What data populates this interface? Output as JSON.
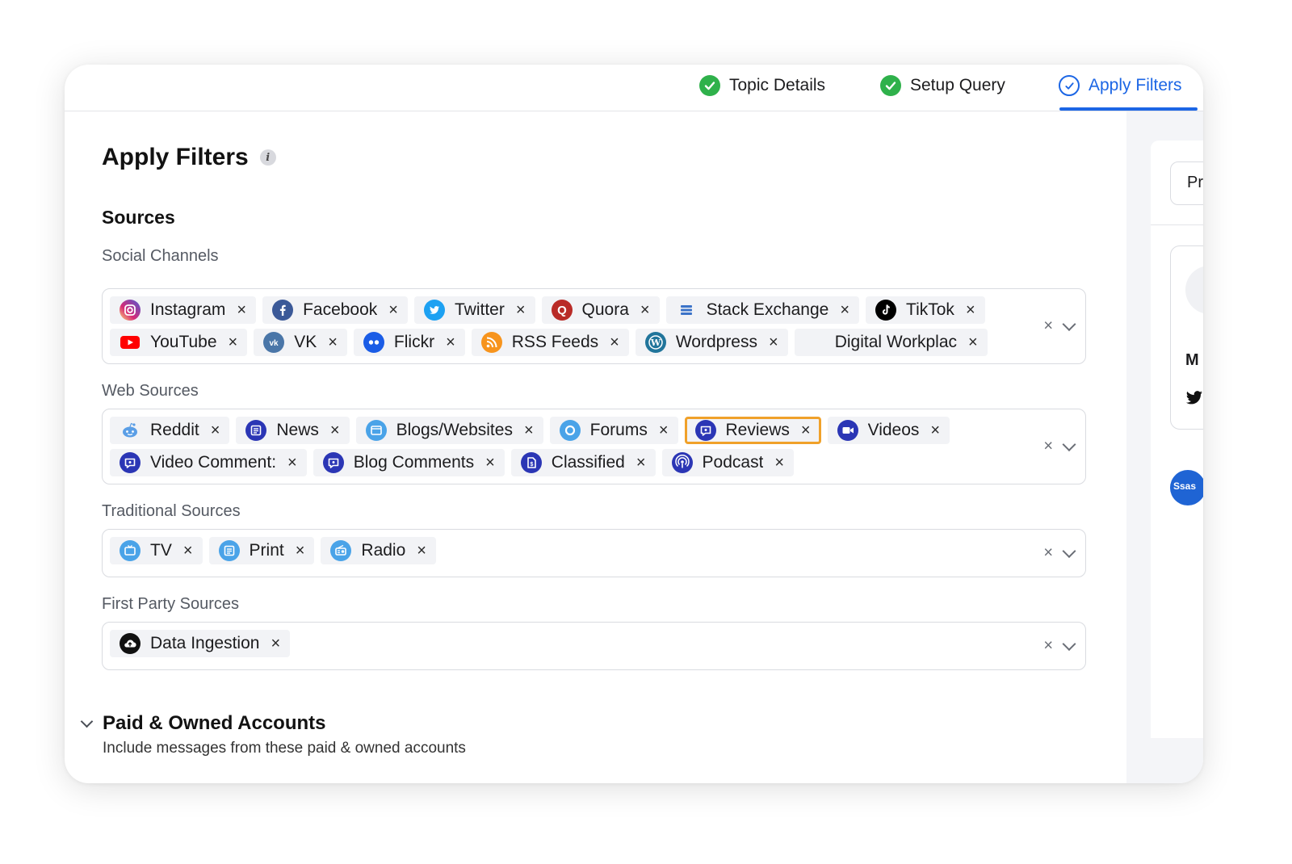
{
  "stepper": {
    "steps": [
      {
        "label": "Topic Details",
        "state": "done"
      },
      {
        "label": "Setup Query",
        "state": "done"
      },
      {
        "label": "Apply Filters",
        "state": "current"
      }
    ]
  },
  "page": {
    "title": "Apply Filters",
    "info_icon": "i",
    "section_title": "Sources"
  },
  "groups": {
    "social": {
      "label": "Social Channels",
      "rows": [
        [
          {
            "label": "Instagram",
            "icon": "instagram-icon",
            "color": "#d62976"
          },
          {
            "label": "Facebook",
            "icon": "facebook-icon",
            "color": "#3b5998"
          },
          {
            "label": "Twitter",
            "icon": "twitter-icon",
            "color": "#1da1f2"
          },
          {
            "label": "Quora",
            "icon": "quora-icon",
            "color": "#b92b27"
          },
          {
            "label": "Stack Exchange",
            "icon": "stack-exchange-icon",
            "color": "#3b73c8"
          },
          {
            "label": "TikTok",
            "icon": "tiktok-icon",
            "color": "#000000"
          }
        ],
        [
          {
            "label": "YouTube",
            "icon": "youtube-icon",
            "color": "#ff0000"
          },
          {
            "label": "VK",
            "icon": "vk-icon",
            "color": "#4a76a8"
          },
          {
            "label": "Flickr",
            "icon": "flickr-icon",
            "color": "#1a5ce6"
          },
          {
            "label": "RSS Feeds",
            "icon": "rss-icon",
            "color": "#f7941d"
          },
          {
            "label": "Wordpress",
            "icon": "wordpress-icon",
            "color": "#21759b"
          },
          {
            "label": "Digital Workplac",
            "icon": "digital-workplace-icon",
            "color": "#f2f3f6"
          }
        ]
      ]
    },
    "web": {
      "label": "Web Sources",
      "rows": [
        [
          {
            "label": "Reddit",
            "icon": "reddit-icon",
            "color": "#5a9ee6"
          },
          {
            "label": "News",
            "icon": "news-icon",
            "color": "#2b36b5"
          },
          {
            "label": "Blogs/Websites",
            "icon": "blogs-icon",
            "color": "#4aa3e8"
          },
          {
            "label": "Forums",
            "icon": "forums-icon",
            "color": "#4aa3e8"
          },
          {
            "label": "Reviews",
            "icon": "reviews-icon",
            "color": "#2b36b5",
            "highlighted": true
          },
          {
            "label": "Videos",
            "icon": "videos-icon",
            "color": "#2b36b5"
          }
        ],
        [
          {
            "label": "Video Comment:",
            "icon": "video-comments-icon",
            "color": "#2b36b5"
          },
          {
            "label": "Blog Comments",
            "icon": "blog-comments-icon",
            "color": "#2b36b5"
          },
          {
            "label": "Classified",
            "icon": "classified-icon",
            "color": "#2b36b5"
          },
          {
            "label": "Podcast",
            "icon": "podcast-icon",
            "color": "#2b36b5"
          }
        ]
      ]
    },
    "traditional": {
      "label": "Traditional Sources",
      "rows": [
        [
          {
            "label": "TV",
            "icon": "tv-icon",
            "color": "#4aa3e8"
          },
          {
            "label": "Print",
            "icon": "print-icon",
            "color": "#4aa3e8"
          },
          {
            "label": "Radio",
            "icon": "radio-icon",
            "color": "#4aa3e8"
          }
        ]
      ]
    },
    "first_party": {
      "label": "First Party Sources",
      "rows": [
        [
          {
            "label": "Data Ingestion",
            "icon": "data-ingestion-icon",
            "color": "#1c1c1e"
          }
        ]
      ]
    }
  },
  "chip_remove_glyph": "×",
  "clear_glyph": "×",
  "paid": {
    "title": "Paid & Owned Accounts",
    "subtitle": "Include messages from these paid & owned accounts"
  },
  "side_panel": {
    "field_text": "Pr",
    "card_text": "M",
    "logo_text": "Ssas"
  },
  "colors": {
    "accent": "#1c66e5",
    "done": "#2fb14b",
    "highlight": "#f0a12a"
  }
}
